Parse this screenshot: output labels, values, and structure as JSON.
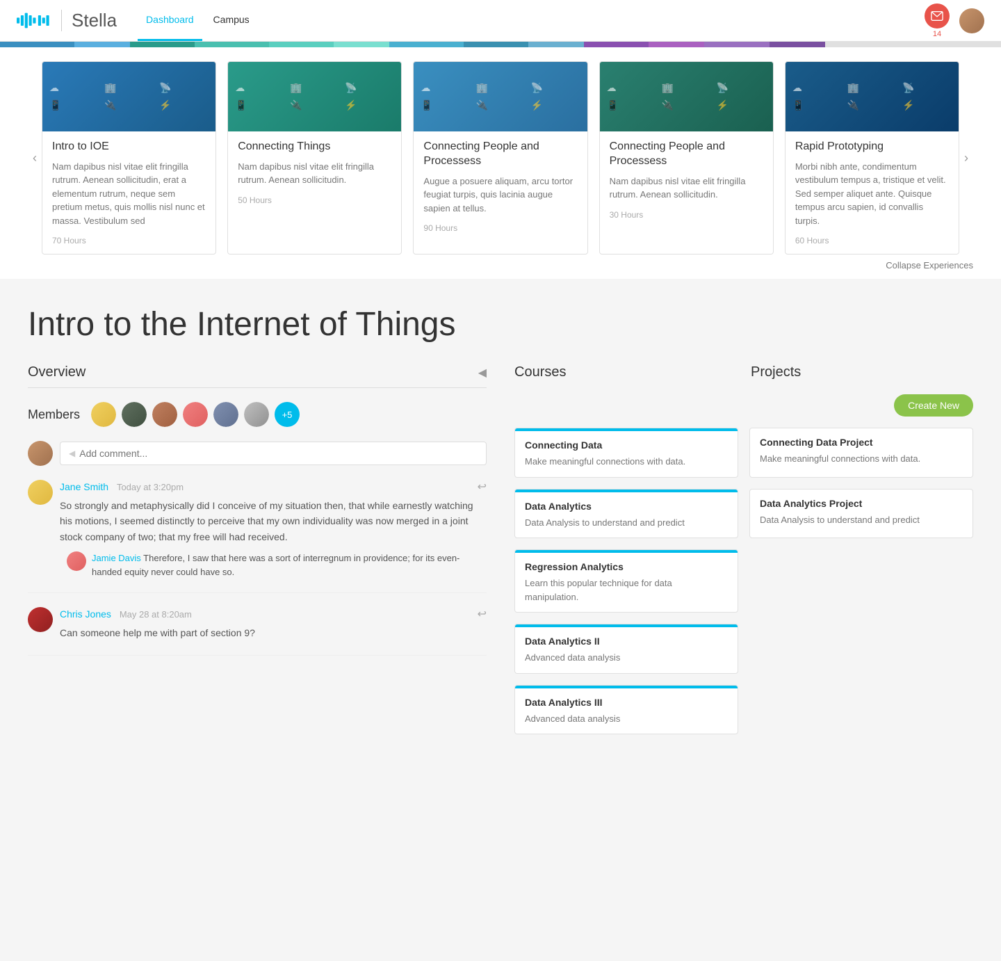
{
  "header": {
    "app_name": "Stella",
    "nav_links": [
      {
        "label": "Dashboard",
        "active": true
      },
      {
        "label": "Campus",
        "active": false
      }
    ],
    "notification_count": "14"
  },
  "progress_segments": [
    {
      "width": "8%",
      "color": "#3a8fc0"
    },
    {
      "width": "6%",
      "color": "#5aafdf"
    },
    {
      "width": "7%",
      "color": "#2a9b8a"
    },
    {
      "width": "8%",
      "color": "#4abfaf"
    },
    {
      "width": "7%",
      "color": "#5acfbf"
    },
    {
      "width": "6%",
      "color": "#7adfd0"
    },
    {
      "width": "8%",
      "color": "#4ab0d0"
    },
    {
      "width": "7%",
      "color": "#3a90b0"
    },
    {
      "width": "6%",
      "color": "#6ab0d0"
    },
    {
      "width": "7%",
      "color": "#8a50b0"
    },
    {
      "width": "6%",
      "color": "#aa60c0"
    },
    {
      "width": "7%",
      "color": "#9a70c0"
    },
    {
      "width": "6%",
      "color": "#7a50a0"
    },
    {
      "width": "19%",
      "color": "#e0e0e0"
    }
  ],
  "experiences": {
    "cards": [
      {
        "title": "Intro to IOE",
        "description": "Nam dapibus nisl vitae elit fringilla rutrum. Aenean sollicitudin, erat a elementum rutrum, neque sem pretium metus, quis mollis nisl nunc et massa. Vestibulum sed",
        "hours": "70 Hours",
        "image_style": "blue"
      },
      {
        "title": "Connecting Things",
        "description": "Nam dapibus nisl vitae elit fringilla rutrum. Aenean sollicitudin.",
        "hours": "50 Hours",
        "image_style": "teal"
      },
      {
        "title": "Connecting People and Processess",
        "description": "Augue a posuere aliquam, arcu tortor feugiat turpis, quis lacinia augue sapien at tellus.",
        "hours": "90 Hours",
        "image_style": "medium-blue"
      },
      {
        "title": "Connecting People and Processess",
        "description": "Nam dapibus nisl vitae elit fringilla rutrum. Aenean sollicitudin.",
        "hours": "30 Hours",
        "image_style": "dark-teal"
      },
      {
        "title": "Rapid Prototyping",
        "description": "Morbi nibh ante, condimentum vestibulum tempus a, tristique et velit. Sed semper aliquet ante. Quisque tempus arcu sapien, id convallis turpis.",
        "hours": "60 Hours",
        "image_style": "dark-blue"
      }
    ],
    "collapse_label": "Collapse Experiences"
  },
  "page": {
    "title": "Intro to the Internet of Things",
    "overview_label": "Overview",
    "members_label": "Members",
    "members_count": "+5",
    "comment_placeholder": "Add comment...",
    "courses_label": "Courses",
    "projects_label": "Projects",
    "create_new_label": "Create New"
  },
  "comments": [
    {
      "author": "Jane Smith",
      "time": "Today at 3:20pm",
      "text": "So strongly and metaphysically did I conceive of my situation then, that while earnestly watching his motions, I seemed distinctly to perceive that my own individuality was now merged in a joint stock company of two; that my free will had received.",
      "avatar_class": "comment-ca1",
      "reply": {
        "author": "Jamie Davis",
        "text": " Therefore, I saw that here was a sort of interregnum in providence; for its even-handed equity never could have so."
      }
    },
    {
      "author": "Chris Jones",
      "time": "May 28 at 8:20am",
      "text": "Can someone help me with part of section 9?",
      "avatar_class": "comment-ca2",
      "reply": null
    }
  ],
  "courses": [
    {
      "title": "Connecting Data",
      "description": "Make meaningful connections with data."
    },
    {
      "title": "Data Analytics",
      "description": "Data Analysis to understand and predict"
    },
    {
      "title": "Regression Analytics",
      "description": "Learn this popular technique for data manipulation."
    },
    {
      "title": "Data Analytics II",
      "description": "Advanced data analysis"
    },
    {
      "title": "Data Analytics III",
      "description": "Advanced data analysis"
    }
  ],
  "projects": [
    {
      "title": "Connecting Data Project",
      "description": "Make meaningful connections with data."
    },
    {
      "title": "Data Analytics Project",
      "description": "Data Analysis to understand and predict"
    }
  ]
}
